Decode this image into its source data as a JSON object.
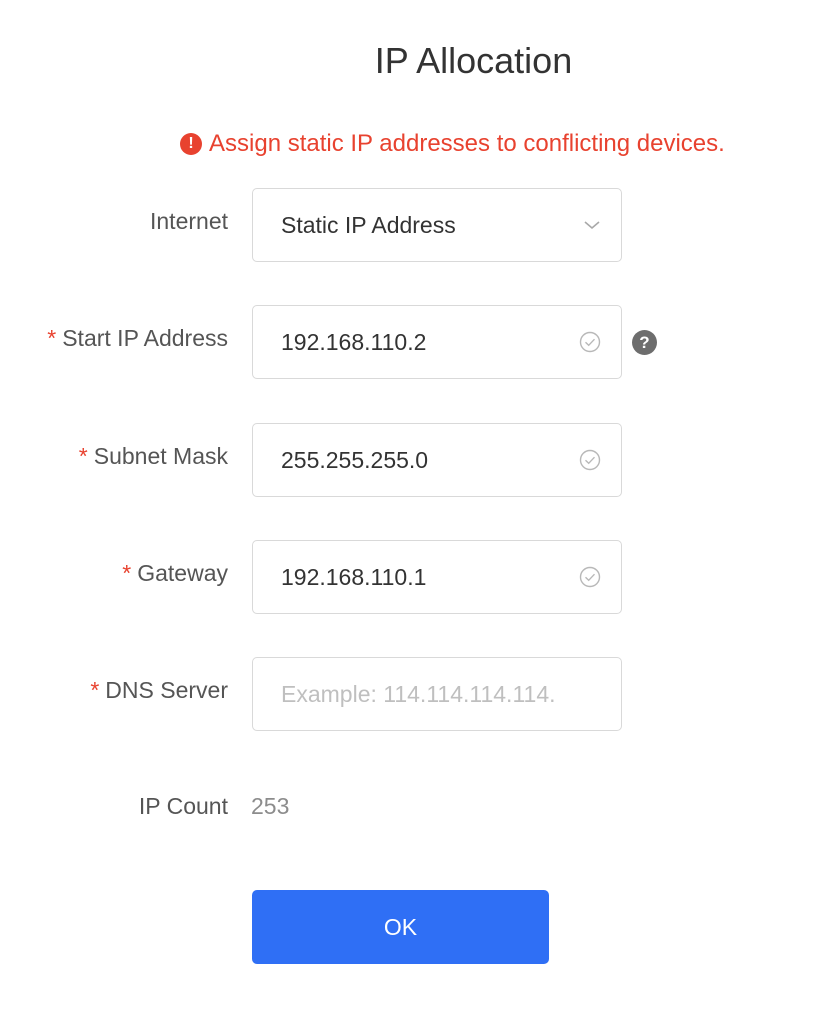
{
  "dialog": {
    "title": "IP Allocation",
    "warning": "Assign static IP addresses to conflicting devices.",
    "warning_icon": "exclamation-circle-icon"
  },
  "form": {
    "internet": {
      "label": "Internet",
      "value": "Static IP Address",
      "icon": "chevron-down-icon"
    },
    "start_ip": {
      "required_mark": "*",
      "label": "Start IP Address",
      "value": "192.168.110.2",
      "icon": "check-circle-icon",
      "help_icon": "question-circle-icon"
    },
    "subnet_mask": {
      "required_mark": "*",
      "label": "Subnet Mask",
      "value": "255.255.255.0",
      "icon": "check-circle-icon"
    },
    "gateway": {
      "required_mark": "*",
      "label": "Gateway",
      "value": "192.168.110.1",
      "icon": "check-circle-icon"
    },
    "dns_server": {
      "required_mark": "*",
      "label": "DNS Server",
      "value": "",
      "placeholder": "Example: 114.114.114.114."
    },
    "ip_count": {
      "label": "IP Count",
      "value": "253"
    }
  },
  "actions": {
    "ok_label": "OK"
  },
  "colors": {
    "error": "#e8422f",
    "primary": "#2f6ff5",
    "border": "#d9d9d9",
    "help_icon": "#6d6d6d"
  }
}
